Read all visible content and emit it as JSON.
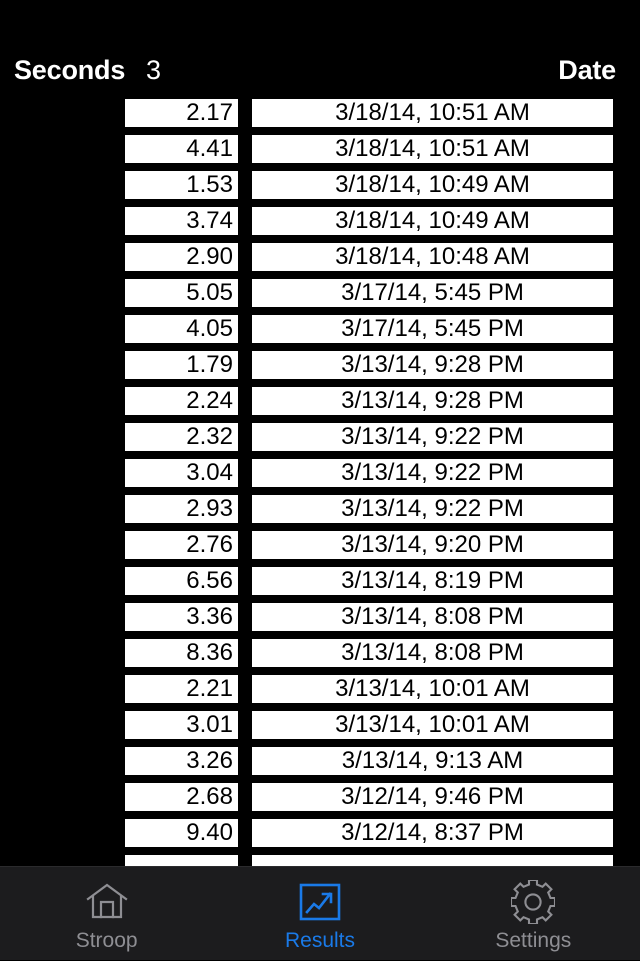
{
  "header": {
    "seconds_label": "Seconds",
    "count_value": "3",
    "date_label": "Date"
  },
  "colors": {
    "background": "#000000",
    "row_background": "#ffffff",
    "row_text": "#000000",
    "header_text": "#ffffff",
    "tab_bar_background": "#1c1c1e",
    "tab_inactive": "#8e8e93",
    "tab_active": "#1a7ae8"
  },
  "results": {
    "columns": [
      "Seconds",
      "Date"
    ],
    "rows": [
      {
        "seconds": "2.17",
        "date": "3/18/14, 10:51 AM"
      },
      {
        "seconds": "4.41",
        "date": "3/18/14, 10:51 AM"
      },
      {
        "seconds": "1.53",
        "date": "3/18/14, 10:49 AM"
      },
      {
        "seconds": "3.74",
        "date": "3/18/14, 10:49 AM"
      },
      {
        "seconds": "2.90",
        "date": "3/18/14, 10:48 AM"
      },
      {
        "seconds": "5.05",
        "date": "3/17/14, 5:45 PM"
      },
      {
        "seconds": "4.05",
        "date": "3/17/14, 5:45 PM"
      },
      {
        "seconds": "1.79",
        "date": "3/13/14, 9:28 PM"
      },
      {
        "seconds": "2.24",
        "date": "3/13/14, 9:28 PM"
      },
      {
        "seconds": "2.32",
        "date": "3/13/14, 9:22 PM"
      },
      {
        "seconds": "3.04",
        "date": "3/13/14, 9:22 PM"
      },
      {
        "seconds": "2.93",
        "date": "3/13/14, 9:22 PM"
      },
      {
        "seconds": "2.76",
        "date": "3/13/14, 9:20 PM"
      },
      {
        "seconds": "6.56",
        "date": "3/13/14, 8:19 PM"
      },
      {
        "seconds": "3.36",
        "date": "3/13/14, 8:08 PM"
      },
      {
        "seconds": "8.36",
        "date": "3/13/14, 8:08 PM"
      },
      {
        "seconds": "2.21",
        "date": "3/13/14, 10:01 AM"
      },
      {
        "seconds": "3.01",
        "date": "3/13/14, 10:01 AM"
      },
      {
        "seconds": "3.26",
        "date": "3/13/14, 9:13 AM"
      },
      {
        "seconds": "2.68",
        "date": "3/12/14, 9:46 PM"
      },
      {
        "seconds": "9.40",
        "date": "3/12/14, 8:37 PM"
      },
      {
        "seconds": "",
        "date": ""
      }
    ]
  },
  "tab_bar": {
    "tabs": [
      {
        "label": "Stroop",
        "icon": "house-icon",
        "active": false
      },
      {
        "label": "Results",
        "icon": "chart-line-icon",
        "active": true
      },
      {
        "label": "Settings",
        "icon": "gear-icon",
        "active": false
      }
    ]
  }
}
